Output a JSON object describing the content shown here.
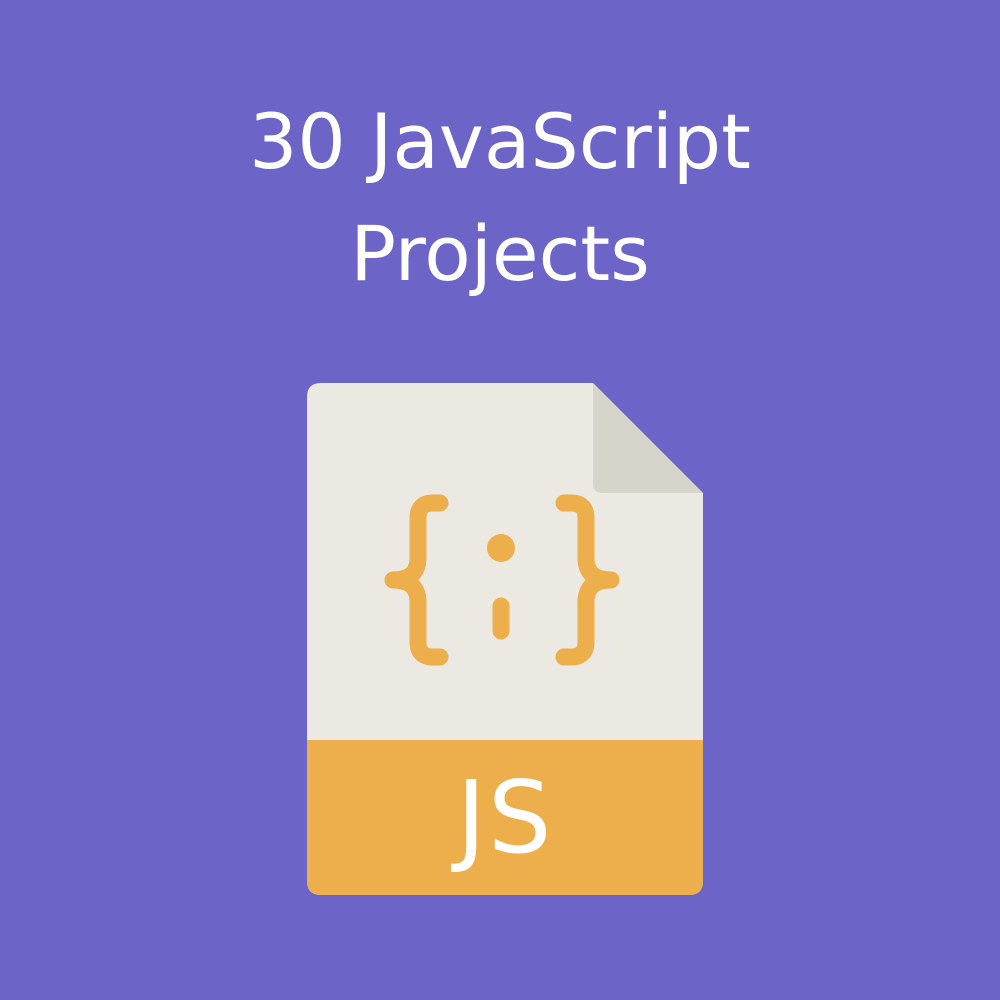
{
  "title": {
    "line1": "30 JavaScript",
    "line2": "Projects"
  },
  "file_icon": {
    "icon": "javascript-file-icon",
    "code_symbol": "curly-braces-semicolon",
    "label": "JS"
  },
  "colors": {
    "background": "#6c64c6",
    "title_text": "#ffffff",
    "page": "#ebe9e1",
    "page_fold": "#d7d4c9",
    "accent": "#ecaf4b",
    "label_text": "#ffffff"
  }
}
